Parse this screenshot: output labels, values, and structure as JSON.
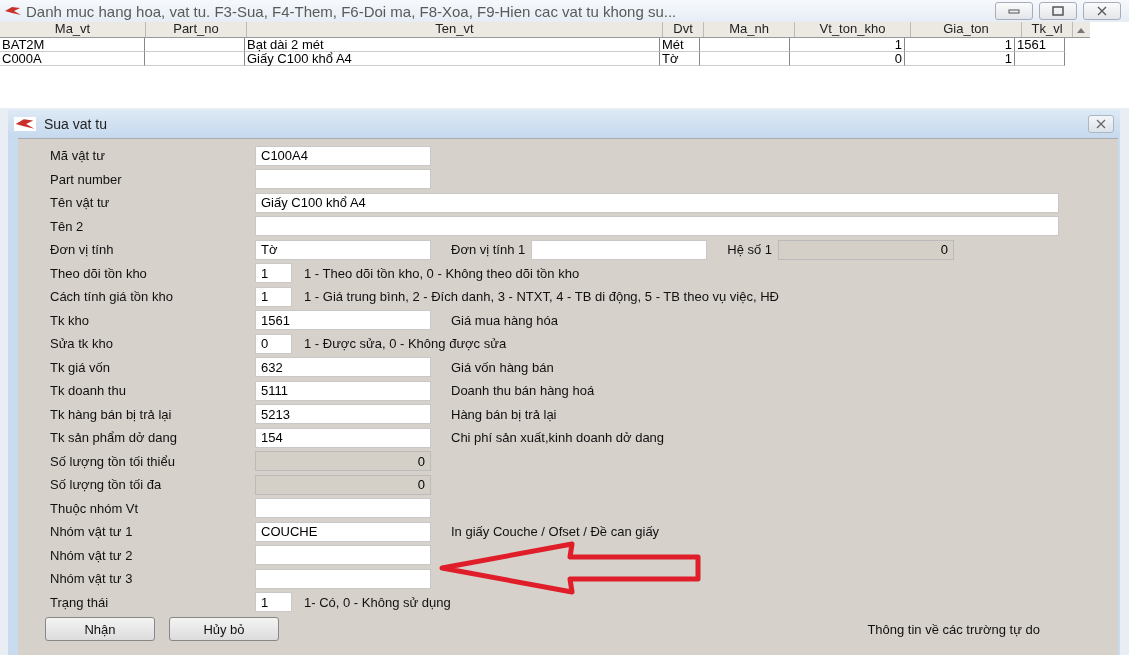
{
  "window": {
    "title": "Danh muc hang hoa, vat tu. F3-Sua, F4-Them, F6-Doi ma, F8-Xoa, F9-Hien cac vat tu khong su..."
  },
  "table": {
    "columns": [
      "Ma_vt",
      "Part_no",
      "Ten_vt",
      "Dvt",
      "Ma_nh",
      "Vt_ton_kho",
      "Gia_ton",
      "Tk_vl"
    ],
    "rows": [
      [
        "BAT2M",
        "",
        "Bạt dài 2 mét",
        "Mét",
        "",
        "1",
        "1",
        "1561"
      ],
      [
        "C000A",
        "",
        "Giấy C100 khổ A4",
        "Tờ",
        "",
        "0",
        "1",
        ""
      ]
    ]
  },
  "dialog": {
    "title": "Sua vat tu",
    "rows": [
      {
        "label": "Mã vật tư",
        "controls": [
          {
            "kind": "field",
            "value": "C100A4",
            "disabled": false
          }
        ]
      },
      {
        "label": "Part number",
        "controls": [
          {
            "kind": "field",
            "disabled": false
          }
        ]
      },
      {
        "label": "Tên vật tư",
        "controls": [
          {
            "kind": "wide",
            "value": "Giấy C100 khổ A4",
            "disabled": false
          }
        ]
      },
      {
        "label": "Tên 2",
        "controls": [
          {
            "kind": "wide",
            "disabled": false
          }
        ]
      },
      {
        "label": "Đơn vị tính",
        "controls": [
          {
            "kind": "field",
            "value": "Tờ",
            "disabled": false
          },
          {
            "kind": "text",
            "text": "Đơn vị tính 1"
          },
          {
            "kind": "field",
            "disabled": false
          },
          {
            "kind": "text",
            "text": "Hệ số 1"
          },
          {
            "kind": "field",
            "value": "0",
            "disabled": true
          }
        ]
      },
      {
        "label": "Theo dõi tồn kho",
        "controls": [
          {
            "kind": "short",
            "value": "1",
            "disabled": false
          },
          {
            "kind": "text",
            "text": "1 - Theo dõi tồn kho, 0 - Không theo dõi tồn kho"
          }
        ]
      },
      {
        "label": "Cách tính giá tồn kho",
        "controls": [
          {
            "kind": "short",
            "value": "1",
            "disabled": false
          },
          {
            "kind": "text",
            "text": "1 - Giá trung bình,  2 - Đích danh,  3 - NTXT, 4 - TB di động, 5 - TB theo vụ việc, HĐ"
          }
        ]
      },
      {
        "label": "Tk kho",
        "controls": [
          {
            "kind": "field",
            "value": "1561",
            "disabled": false
          },
          {
            "kind": "text",
            "text": "Giá mua hàng hóa"
          }
        ]
      },
      {
        "label": "Sửa tk kho",
        "controls": [
          {
            "kind": "short",
            "value": "0",
            "disabled": false
          },
          {
            "kind": "text",
            "text": "1 - Được sửa,  0 - Không được sửa"
          }
        ]
      },
      {
        "label": "Tk giá vốn",
        "controls": [
          {
            "kind": "field",
            "value": "632",
            "disabled": false
          },
          {
            "kind": "text",
            "text": "Giá vốn hàng bán"
          }
        ]
      },
      {
        "label": "Tk doanh thu",
        "controls": [
          {
            "kind": "field",
            "value": "5111",
            "disabled": false
          },
          {
            "kind": "text",
            "text": "Doanh thu bán hàng hoá"
          }
        ]
      },
      {
        "label": "Tk hàng bán bị trả lại",
        "controls": [
          {
            "kind": "field",
            "value": "5213",
            "disabled": false
          },
          {
            "kind": "text",
            "text": "Hàng bán bị trả lại"
          }
        ]
      },
      {
        "label": "Tk sản phẩm dở dang",
        "controls": [
          {
            "kind": "field",
            "value": "154",
            "disabled": false
          },
          {
            "kind": "text",
            "text": "Chi phí sản xuất,kinh doanh dở dang"
          }
        ]
      },
      {
        "label": "Số lượng tồn tối thiểu",
        "controls": [
          {
            "kind": "field",
            "value": "0",
            "disabled": true
          }
        ]
      },
      {
        "label": "Số lượng tồn tối đa",
        "controls": [
          {
            "kind": "field",
            "value": "0",
            "disabled": true
          }
        ]
      },
      {
        "label": "Thuộc nhóm Vt",
        "controls": [
          {
            "kind": "field",
            "disabled": false
          }
        ]
      },
      {
        "label": "Nhóm vật tư 1",
        "controls": [
          {
            "kind": "field",
            "value": "COUCHE",
            "disabled": false
          },
          {
            "kind": "text",
            "text": "In giấy Couche / Ofset / Đề can giấy"
          }
        ]
      },
      {
        "label": "Nhóm vật tư 2",
        "controls": [
          {
            "kind": "field",
            "disabled": false
          }
        ]
      },
      {
        "label": "Nhóm vật tư 3",
        "controls": [
          {
            "kind": "field",
            "disabled": false
          }
        ]
      },
      {
        "label": "Trạng thái",
        "controls": [
          {
            "kind": "short",
            "value": "1",
            "disabled": false
          },
          {
            "kind": "text",
            "text": "1- Có, 0 - Không sử dụng"
          }
        ]
      }
    ],
    "buttons": [
      "Nhận",
      "Hủy bỏ"
    ],
    "link": "Thông tin về các trường tự do"
  }
}
